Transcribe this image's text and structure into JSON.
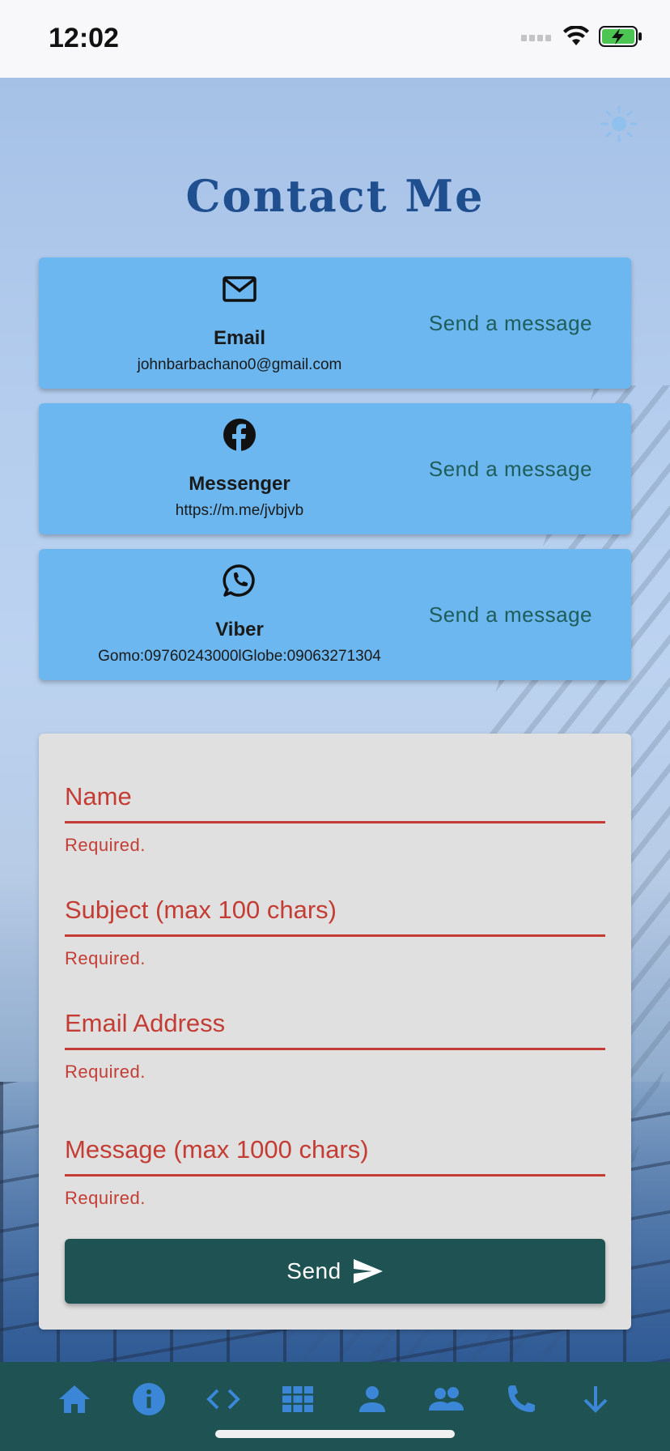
{
  "status_bar": {
    "time": "12:02"
  },
  "page": {
    "title": "Contact Me"
  },
  "contacts": [
    {
      "title": "Email",
      "detail": "johnbarbachano0@gmail.com",
      "action": "Send a message",
      "icon": "mail-icon"
    },
    {
      "title": "Messenger",
      "detail": "https://m.me/jvbjvb",
      "action": "Send a message",
      "icon": "facebook-icon"
    },
    {
      "title": "Viber",
      "detail": "Gomo:09760243000lGlobe:09063271304",
      "action": "Send a message",
      "icon": "whatsapp-icon"
    }
  ],
  "form": {
    "fields": [
      {
        "label": "Name",
        "error": "Required."
      },
      {
        "label": "Subject (max 100 chars)",
        "error": "Required."
      },
      {
        "label": "Email Address",
        "error": "Required."
      },
      {
        "label": "Message (max 1000 chars)",
        "error": "Required."
      }
    ],
    "send_label": "Send"
  },
  "nav": {
    "items": [
      "home-icon",
      "info-icon",
      "code-icon",
      "apps-icon",
      "person-icon",
      "people-icon",
      "phone-icon",
      "arrow-down-icon"
    ]
  },
  "colors": {
    "accent": "#1e5253",
    "card": "#6cb7ef",
    "error": "#c43d35",
    "title": "#1f4f8f",
    "nav_icon": "#3b86d6"
  }
}
